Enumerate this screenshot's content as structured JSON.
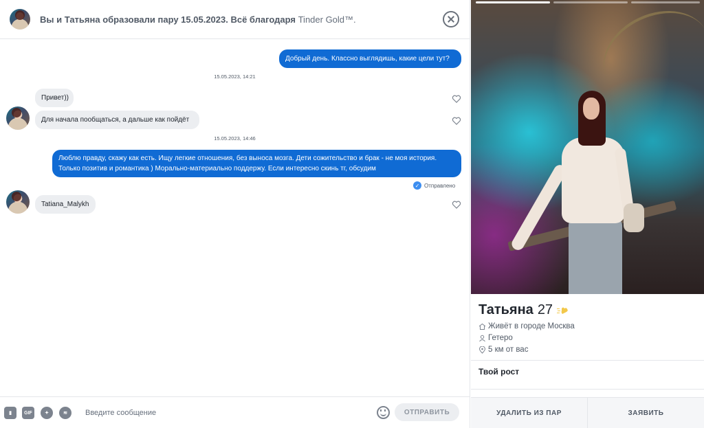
{
  "chat": {
    "header": {
      "match_text": "Вы и Татьяна образовали пару 15.05.2023. Всё благодаря",
      "gold_text": "Tinder Gold™."
    },
    "messages": [
      {
        "dir": "out",
        "text": "Добрый день. Классно выглядишь, какие цели тут?"
      },
      {
        "dir": "ts",
        "text": "15.05.2023, 14:21"
      },
      {
        "dir": "in",
        "text": "Привет))"
      },
      {
        "dir": "in",
        "text": "Для начала пообщаться, а дальше как пойдёт"
      },
      {
        "dir": "ts",
        "text": "15.05.2023, 14:46"
      },
      {
        "dir": "out",
        "text": "Люблю правду, скажу как есть. Ищу легкие отношения, без выноса мозга. Дети сожительство и брак - не моя история. Только позитив и романтика ) Морально-материально поддержу. Если интересно скинь тг, обсудим"
      },
      {
        "dir": "in",
        "text": "Tatiana_Malykh"
      }
    ],
    "sent_status": "Отправлено",
    "composer": {
      "placeholder": "Введите сообщение",
      "send_label": "ОТПРАВИТЬ",
      "gif_label": "GIF"
    }
  },
  "profile": {
    "name": "Татьяна",
    "age": "27",
    "details": [
      {
        "icon": "home-icon",
        "text": "Живёт в городе Москва"
      },
      {
        "icon": "person-icon",
        "text": "Гетеро"
      },
      {
        "icon": "location-pin-icon",
        "text": "5 км от вас"
      }
    ],
    "section_title": "Твой рост",
    "actions": {
      "unmatch": "УДАЛИТЬ ИЗ ПАР",
      "report": "ЗАЯВИТЬ"
    }
  },
  "colors": {
    "outgoing_bubble": "#106bd4",
    "incoming_bubble": "#eceef1",
    "gold": "#f2c84b"
  }
}
